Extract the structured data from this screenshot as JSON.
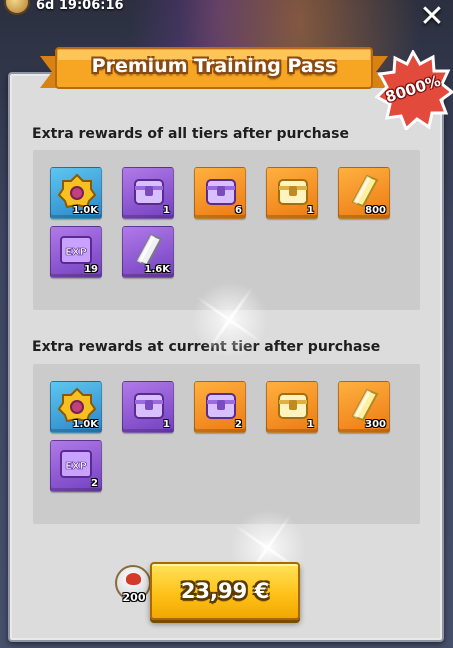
{
  "header": {
    "timer": "6d 19:06:16",
    "close_symbol": "✕"
  },
  "banner": {
    "title": "Premium Training Pass",
    "badge": "8000%"
  },
  "section_all": {
    "title": "Extra rewards of all tiers after purchase",
    "items": [
      {
        "icon": "gold-gear-icon",
        "color": "blue",
        "qty": "1.0K"
      },
      {
        "icon": "purple-chest-icon",
        "color": "purple",
        "qty": "1"
      },
      {
        "icon": "purple-chest-icon",
        "color": "orange",
        "qty": "6"
      },
      {
        "icon": "gold-chest-icon",
        "color": "orange",
        "qty": "1"
      },
      {
        "icon": "gold-bar-icon",
        "color": "orange",
        "qty": "800"
      },
      {
        "icon": "exp-book-icon",
        "color": "purple",
        "qty": "19"
      },
      {
        "icon": "silver-bar-icon",
        "color": "purple",
        "qty": "1.6K"
      }
    ]
  },
  "section_current": {
    "title": "Extra rewards at current tier after purchase",
    "items": [
      {
        "icon": "gold-gear-icon",
        "color": "blue",
        "qty": "1.0K"
      },
      {
        "icon": "purple-chest-icon",
        "color": "purple",
        "qty": "1"
      },
      {
        "icon": "purple-chest-icon",
        "color": "orange",
        "qty": "2"
      },
      {
        "icon": "gold-chest-icon",
        "color": "orange",
        "qty": "1"
      },
      {
        "icon": "gold-bar-icon",
        "color": "orange",
        "qty": "300"
      },
      {
        "icon": "exp-book-icon",
        "color": "purple",
        "qty": "2"
      }
    ]
  },
  "purchase": {
    "cost_value": "200",
    "price": "23,99 €"
  },
  "colors": {
    "banner_orange": "#f6a623",
    "badge_red": "#e24b3b",
    "button_yellow": "#ffc21a"
  }
}
